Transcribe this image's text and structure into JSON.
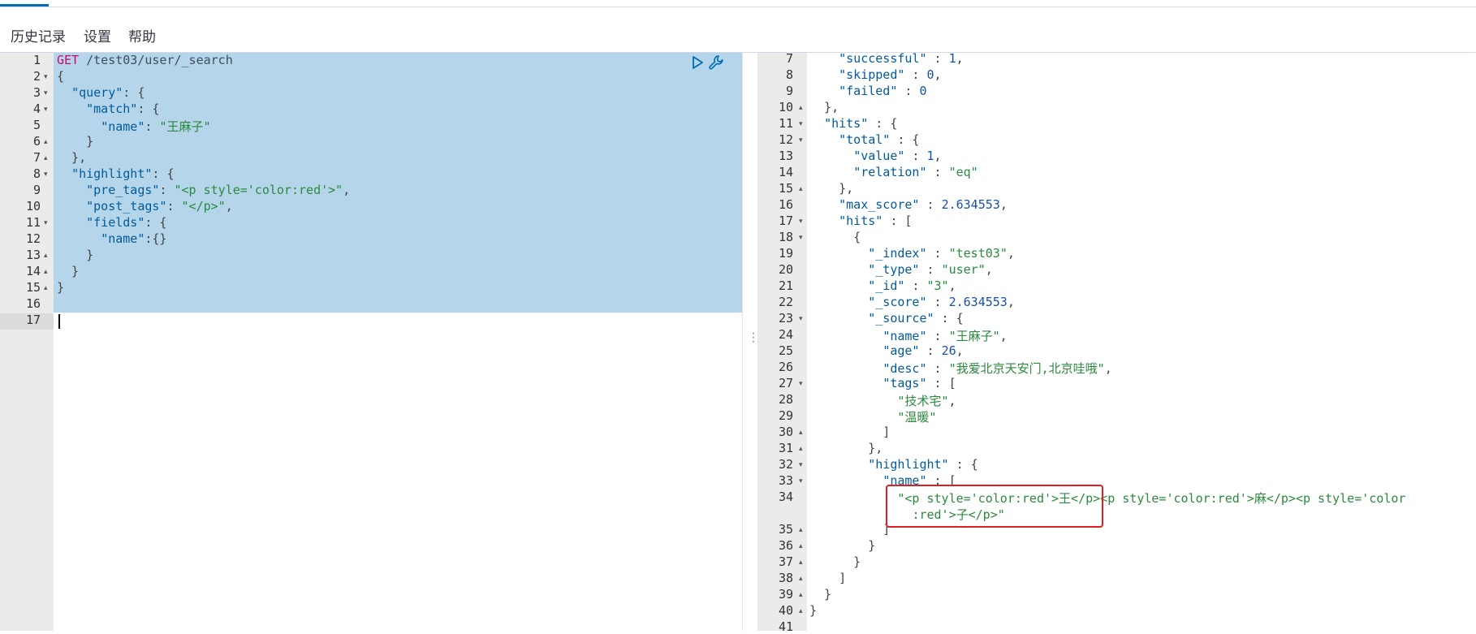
{
  "menu": {
    "history": "历史记录",
    "settings": "设置",
    "help": "帮助"
  },
  "request": {
    "lines": [
      {
        "n": "1",
        "fold": "",
        "parts": [
          [
            "method",
            "GET"
          ],
          [
            "url",
            " /test03/user/_search"
          ]
        ]
      },
      {
        "n": "2",
        "fold": "▾",
        "parts": [
          [
            "punct",
            "{"
          ]
        ]
      },
      {
        "n": "3",
        "fold": "▾",
        "parts": [
          [
            "punct",
            "  "
          ],
          [
            "key",
            "\"query\""
          ],
          [
            "punct",
            ": {"
          ]
        ]
      },
      {
        "n": "4",
        "fold": "▾",
        "parts": [
          [
            "punct",
            "    "
          ],
          [
            "key",
            "\"match\""
          ],
          [
            "punct",
            ": {"
          ]
        ]
      },
      {
        "n": "5",
        "fold": "",
        "parts": [
          [
            "punct",
            "      "
          ],
          [
            "key",
            "\"name\""
          ],
          [
            "punct",
            ": "
          ],
          [
            "str",
            "\"王麻子\""
          ]
        ]
      },
      {
        "n": "6",
        "fold": "▴",
        "parts": [
          [
            "punct",
            "    }"
          ]
        ]
      },
      {
        "n": "7",
        "fold": "▴",
        "parts": [
          [
            "punct",
            "  },"
          ]
        ]
      },
      {
        "n": "8",
        "fold": "▾",
        "parts": [
          [
            "punct",
            "  "
          ],
          [
            "key",
            "\"highlight\""
          ],
          [
            "punct",
            ": {"
          ]
        ]
      },
      {
        "n": "9",
        "fold": "",
        "parts": [
          [
            "punct",
            "    "
          ],
          [
            "key",
            "\"pre_tags\""
          ],
          [
            "punct",
            ": "
          ],
          [
            "str",
            "\"<p style='color:red'>\""
          ],
          [
            "punct",
            ","
          ]
        ]
      },
      {
        "n": "10",
        "fold": "",
        "parts": [
          [
            "punct",
            "    "
          ],
          [
            "key",
            "\"post_tags\""
          ],
          [
            "punct",
            ": "
          ],
          [
            "str",
            "\"</p>\""
          ],
          [
            "punct",
            ","
          ]
        ]
      },
      {
        "n": "11",
        "fold": "▾",
        "parts": [
          [
            "punct",
            "    "
          ],
          [
            "key",
            "\"fields\""
          ],
          [
            "punct",
            ": {"
          ]
        ]
      },
      {
        "n": "12",
        "fold": "",
        "parts": [
          [
            "punct",
            "      "
          ],
          [
            "key",
            "\"name\""
          ],
          [
            "punct",
            ":{}"
          ]
        ]
      },
      {
        "n": "13",
        "fold": "▴",
        "parts": [
          [
            "punct",
            "    }"
          ]
        ]
      },
      {
        "n": "14",
        "fold": "▴",
        "parts": [
          [
            "punct",
            "  }"
          ]
        ]
      },
      {
        "n": "15",
        "fold": "▴",
        "parts": [
          [
            "punct",
            "}"
          ]
        ]
      },
      {
        "n": "16",
        "fold": "",
        "parts": []
      },
      {
        "n": "17",
        "fold": "",
        "parts": []
      }
    ]
  },
  "response": {
    "lines": [
      {
        "n": "7",
        "fold": "",
        "parts": [
          [
            "punct",
            "    "
          ],
          [
            "key",
            "\"successful\""
          ],
          [
            "punct",
            " : "
          ],
          [
            "num",
            "1"
          ],
          [
            "punct",
            ","
          ]
        ]
      },
      {
        "n": "8",
        "fold": "",
        "parts": [
          [
            "punct",
            "    "
          ],
          [
            "key",
            "\"skipped\""
          ],
          [
            "punct",
            " : "
          ],
          [
            "num",
            "0"
          ],
          [
            "punct",
            ","
          ]
        ]
      },
      {
        "n": "9",
        "fold": "",
        "parts": [
          [
            "punct",
            "    "
          ],
          [
            "key",
            "\"failed\""
          ],
          [
            "punct",
            " : "
          ],
          [
            "num",
            "0"
          ]
        ]
      },
      {
        "n": "10",
        "fold": "▴",
        "parts": [
          [
            "punct",
            "  },"
          ]
        ]
      },
      {
        "n": "11",
        "fold": "▾",
        "parts": [
          [
            "punct",
            "  "
          ],
          [
            "key",
            "\"hits\""
          ],
          [
            "punct",
            " : {"
          ]
        ]
      },
      {
        "n": "12",
        "fold": "▾",
        "parts": [
          [
            "punct",
            "    "
          ],
          [
            "key",
            "\"total\""
          ],
          [
            "punct",
            " : {"
          ]
        ]
      },
      {
        "n": "13",
        "fold": "",
        "parts": [
          [
            "punct",
            "      "
          ],
          [
            "key",
            "\"value\""
          ],
          [
            "punct",
            " : "
          ],
          [
            "num",
            "1"
          ],
          [
            "punct",
            ","
          ]
        ]
      },
      {
        "n": "14",
        "fold": "",
        "parts": [
          [
            "punct",
            "      "
          ],
          [
            "key",
            "\"relation\""
          ],
          [
            "punct",
            " : "
          ],
          [
            "str",
            "\"eq\""
          ]
        ]
      },
      {
        "n": "15",
        "fold": "▴",
        "parts": [
          [
            "punct",
            "    },"
          ]
        ]
      },
      {
        "n": "16",
        "fold": "",
        "parts": [
          [
            "punct",
            "    "
          ],
          [
            "key",
            "\"max_score\""
          ],
          [
            "punct",
            " : "
          ],
          [
            "num",
            "2.634553"
          ],
          [
            "punct",
            ","
          ]
        ]
      },
      {
        "n": "17",
        "fold": "▾",
        "parts": [
          [
            "punct",
            "    "
          ],
          [
            "key",
            "\"hits\""
          ],
          [
            "punct",
            " : ["
          ]
        ]
      },
      {
        "n": "18",
        "fold": "▾",
        "parts": [
          [
            "punct",
            "      {"
          ]
        ]
      },
      {
        "n": "19",
        "fold": "",
        "parts": [
          [
            "punct",
            "        "
          ],
          [
            "key",
            "\"_index\""
          ],
          [
            "punct",
            " : "
          ],
          [
            "str",
            "\"test03\""
          ],
          [
            "punct",
            ","
          ]
        ]
      },
      {
        "n": "20",
        "fold": "",
        "parts": [
          [
            "punct",
            "        "
          ],
          [
            "key",
            "\"_type\""
          ],
          [
            "punct",
            " : "
          ],
          [
            "str",
            "\"user\""
          ],
          [
            "punct",
            ","
          ]
        ]
      },
      {
        "n": "21",
        "fold": "",
        "parts": [
          [
            "punct",
            "        "
          ],
          [
            "key",
            "\"_id\""
          ],
          [
            "punct",
            " : "
          ],
          [
            "str",
            "\"3\""
          ],
          [
            "punct",
            ","
          ]
        ]
      },
      {
        "n": "22",
        "fold": "",
        "parts": [
          [
            "punct",
            "        "
          ],
          [
            "key",
            "\"_score\""
          ],
          [
            "punct",
            " : "
          ],
          [
            "num",
            "2.634553"
          ],
          [
            "punct",
            ","
          ]
        ]
      },
      {
        "n": "23",
        "fold": "▾",
        "parts": [
          [
            "punct",
            "        "
          ],
          [
            "key",
            "\"_source\""
          ],
          [
            "punct",
            " : {"
          ]
        ]
      },
      {
        "n": "24",
        "fold": "",
        "parts": [
          [
            "punct",
            "          "
          ],
          [
            "key",
            "\"name\""
          ],
          [
            "punct",
            " : "
          ],
          [
            "str",
            "\"王麻子\""
          ],
          [
            "punct",
            ","
          ]
        ]
      },
      {
        "n": "25",
        "fold": "",
        "parts": [
          [
            "punct",
            "          "
          ],
          [
            "key",
            "\"age\""
          ],
          [
            "punct",
            " : "
          ],
          [
            "num",
            "26"
          ],
          [
            "punct",
            ","
          ]
        ]
      },
      {
        "n": "26",
        "fold": "",
        "parts": [
          [
            "punct",
            "          "
          ],
          [
            "key",
            "\"desc\""
          ],
          [
            "punct",
            " : "
          ],
          [
            "str",
            "\"我爱北京天安门,北京哇哦\""
          ],
          [
            "punct",
            ","
          ]
        ]
      },
      {
        "n": "27",
        "fold": "▾",
        "parts": [
          [
            "punct",
            "          "
          ],
          [
            "key",
            "\"tags\""
          ],
          [
            "punct",
            " : ["
          ]
        ]
      },
      {
        "n": "28",
        "fold": "",
        "parts": [
          [
            "punct",
            "            "
          ],
          [
            "str",
            "\"技术宅\""
          ],
          [
            "punct",
            ","
          ]
        ]
      },
      {
        "n": "29",
        "fold": "",
        "parts": [
          [
            "punct",
            "            "
          ],
          [
            "str",
            "\"温暖\""
          ]
        ]
      },
      {
        "n": "30",
        "fold": "▴",
        "parts": [
          [
            "punct",
            "          ]"
          ]
        ]
      },
      {
        "n": "31",
        "fold": "▴",
        "parts": [
          [
            "punct",
            "        },"
          ]
        ]
      },
      {
        "n": "32",
        "fold": "▾",
        "parts": [
          [
            "punct",
            "        "
          ],
          [
            "key",
            "\"highlight\""
          ],
          [
            "punct",
            " : {"
          ]
        ]
      },
      {
        "n": "33",
        "fold": "▾",
        "parts": [
          [
            "punct",
            "          "
          ],
          [
            "key",
            "\"name\""
          ],
          [
            "punct",
            " : ["
          ]
        ]
      },
      {
        "n": "34",
        "fold": "",
        "parts": [
          [
            "punct",
            "            "
          ],
          [
            "str",
            "\"<p style='color:red'>王</p><p style='color:red'>麻</p><p style='color"
          ]
        ]
      },
      {
        "n": "",
        "fold": "",
        "parts": [
          [
            "punct",
            "              "
          ],
          [
            "str",
            ":red'>子</p>\""
          ]
        ]
      },
      {
        "n": "35",
        "fold": "▴",
        "parts": [
          [
            "punct",
            "          ]"
          ]
        ]
      },
      {
        "n": "36",
        "fold": "▴",
        "parts": [
          [
            "punct",
            "        }"
          ]
        ]
      },
      {
        "n": "37",
        "fold": "▴",
        "parts": [
          [
            "punct",
            "      }"
          ]
        ]
      },
      {
        "n": "38",
        "fold": "▴",
        "parts": [
          [
            "punct",
            "    ]"
          ]
        ]
      },
      {
        "n": "39",
        "fold": "▴",
        "parts": [
          [
            "punct",
            "  }"
          ]
        ]
      },
      {
        "n": "40",
        "fold": "▴",
        "parts": [
          [
            "punct",
            "}"
          ]
        ]
      },
      {
        "n": "41",
        "fold": "",
        "parts": []
      }
    ]
  },
  "icons": {
    "run": "play-icon",
    "wrench": "wrench-icon",
    "resize": "drag-handle-icon"
  },
  "colors": {
    "selection": "#b5d5ea",
    "highlight_box": "#e02020",
    "key": "#005a9e",
    "string": "#2b8a3e",
    "method": "#c80a68"
  }
}
